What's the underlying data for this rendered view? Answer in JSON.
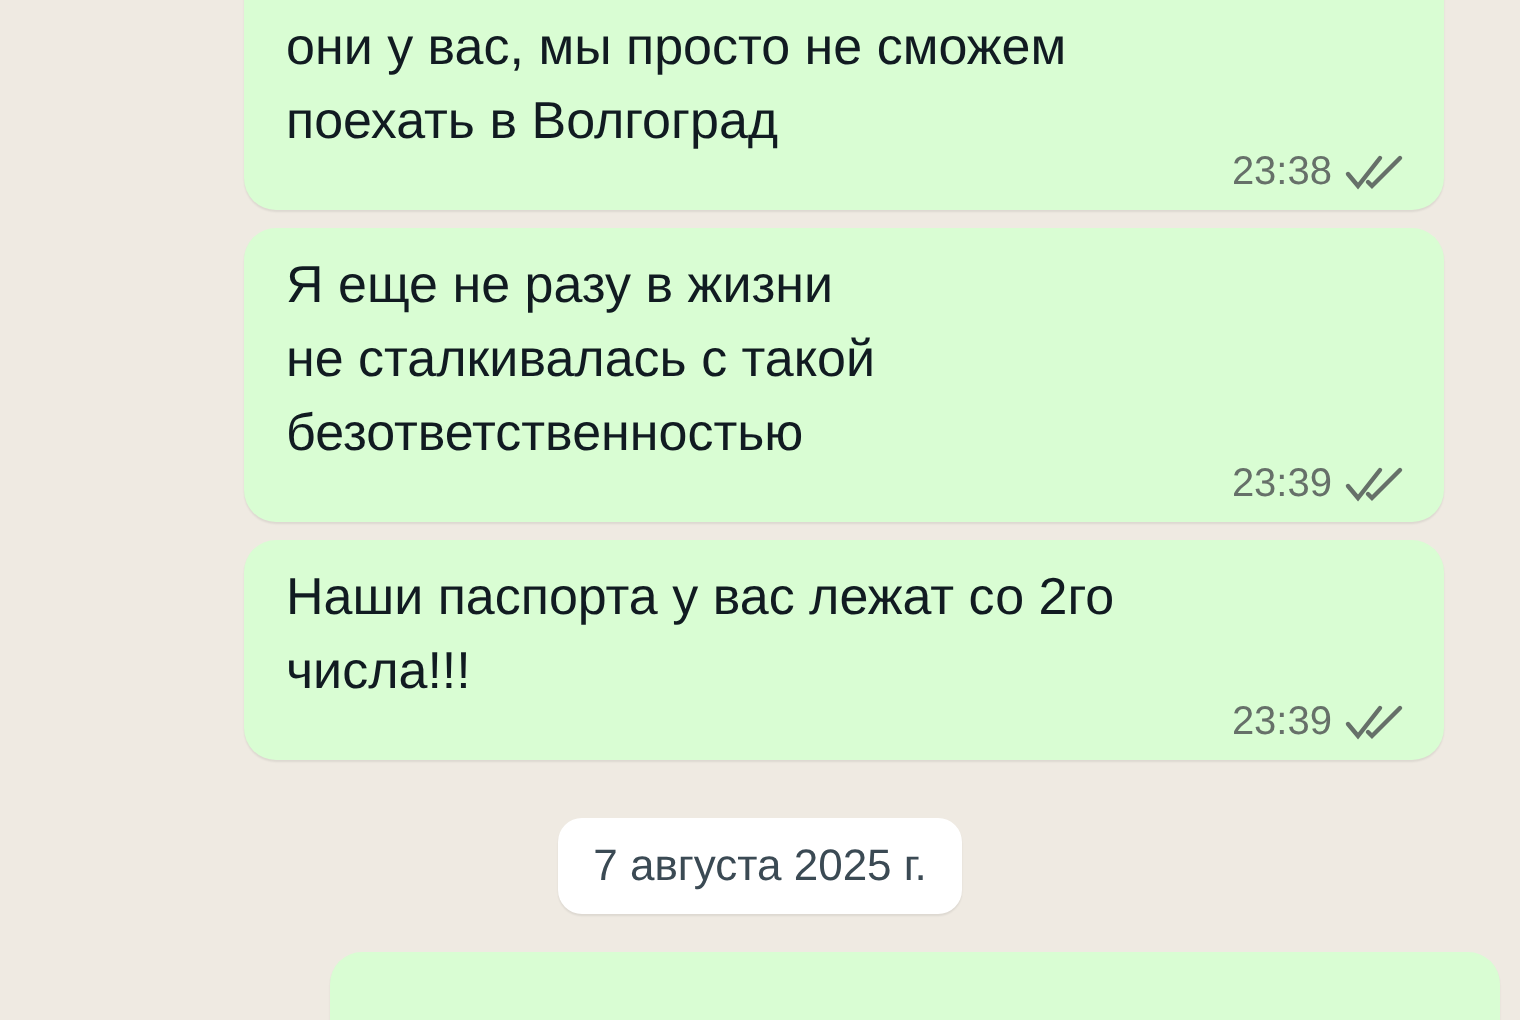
{
  "messages": [
    {
      "lines": [
        "они у вас, мы просто не сможем",
        "поехать в Волгоград"
      ],
      "time": "23:38",
      "read": false
    },
    {
      "lines": [
        "Я еще не разу в жизни",
        "не сталкивалась с такой",
        "безответственностью"
      ],
      "time": "23:39",
      "read": false
    },
    {
      "lines": [
        "Наши паспорта у вас лежат со 2го",
        "числа!!!"
      ],
      "time": "23:39",
      "read": false
    }
  ],
  "date_divider": "7 августа 2025 г."
}
